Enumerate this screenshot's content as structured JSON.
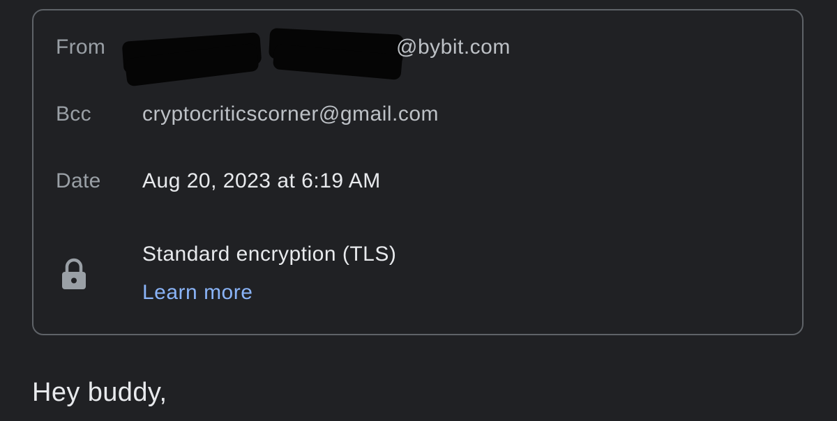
{
  "header": {
    "from": {
      "label": "From",
      "value_visible": "@bybit.com"
    },
    "bcc": {
      "label": "Bcc",
      "value": "cryptocriticscorner@gmail.com"
    },
    "date": {
      "label": "Date",
      "value": "Aug 20, 2023 at 6:19 AM"
    },
    "security": {
      "icon": "lock-icon",
      "text": "Standard encryption (TLS)",
      "link": "Learn more"
    }
  },
  "body": {
    "greeting": "Hey buddy,"
  },
  "colors": {
    "background": "#202124",
    "border": "#5f6368",
    "label": "#9aa0a6",
    "link": "#8ab4f8"
  }
}
